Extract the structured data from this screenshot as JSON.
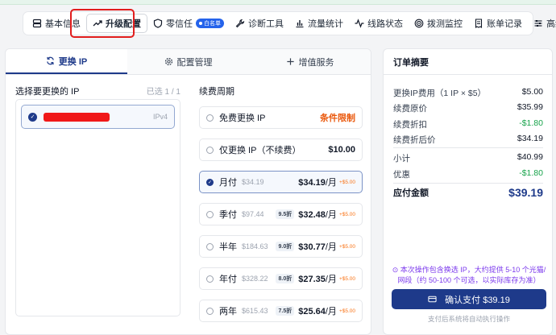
{
  "nav": {
    "items": [
      {
        "label": "基本信息",
        "icon": "server-icon"
      },
      {
        "label": "升级配置",
        "icon": "trending-up-icon"
      },
      {
        "label": "零信任",
        "icon": "shield-icon",
        "badge": "白名单"
      },
      {
        "label": "诊断工具",
        "icon": "wrench-icon"
      },
      {
        "label": "流量统计",
        "icon": "bar-chart-icon"
      },
      {
        "label": "线路状态",
        "icon": "activity-icon"
      },
      {
        "label": "拨测监控",
        "icon": "target-icon"
      },
      {
        "label": "账单记录",
        "icon": "receipt-icon"
      },
      {
        "label": "高级设置",
        "icon": "sliders-icon"
      }
    ],
    "active_index": 1
  },
  "tabs": [
    {
      "label": "更换 IP",
      "icon": "refresh-icon"
    },
    {
      "label": "配置管理",
      "icon": "gear-icon"
    },
    {
      "label": "增值服务",
      "icon": "plus-icon"
    }
  ],
  "ip_select": {
    "title": "选择要更换的 IP",
    "count": "已选 1 / 1",
    "items": [
      {
        "tag": "IPv4",
        "selected": true
      }
    ]
  },
  "renew": {
    "title": "续费周期",
    "plans": [
      {
        "name": "免费更换 IP",
        "limit": "条件限制"
      },
      {
        "name": "仅更换 IP（不续费）",
        "price": "$10.00"
      },
      {
        "name": "月付",
        "orig": "$34.19",
        "price": "$34.19",
        "unit": "/月",
        "extra": "+$5.00",
        "selected": true
      },
      {
        "name": "季付",
        "orig": "$97.44",
        "discount": "9.5折",
        "price": "$32.48",
        "unit": "/月",
        "extra": "+$5.00"
      },
      {
        "name": "半年",
        "orig": "$184.63",
        "discount": "9.0折",
        "price": "$30.77",
        "unit": "/月",
        "extra": "+$5.00"
      },
      {
        "name": "年付",
        "orig": "$328.22",
        "discount": "8.0折",
        "price": "$27.35",
        "unit": "/月",
        "extra": "+$5.00"
      },
      {
        "name": "两年",
        "orig": "$615.43",
        "discount": "7.5折",
        "price": "$25.64",
        "unit": "/月",
        "extra": "+$5.00"
      }
    ]
  },
  "summary": {
    "title": "订单摘要",
    "rows": [
      {
        "label": "更换IP费用（1 IP × $5）",
        "value": "$5.00"
      },
      {
        "label": "续费原价",
        "value": "$35.99"
      },
      {
        "label": "续费折扣",
        "value": "-$1.80",
        "green": true
      },
      {
        "label": "续费折后价",
        "value": "$34.19"
      }
    ],
    "rows2": [
      {
        "label": "小计",
        "value": "$40.99"
      },
      {
        "label": "优惠",
        "value": "-$1.80",
        "green": true
      }
    ],
    "total_label": "应付金额",
    "total_value": "$39.19",
    "note": "本次操作包含换选 IP，大约提供 5-10 个光猫/网段（约 50-100 个可选，以实际库存为准）",
    "pay_label": "确认支付 $39.19",
    "foot_note": "支付后系统将自动执行操作"
  },
  "colors": {
    "accent": "#1e3a8a",
    "warning": "#ea580c",
    "discount": "#16a34a",
    "highlight": "#e11d1d"
  }
}
